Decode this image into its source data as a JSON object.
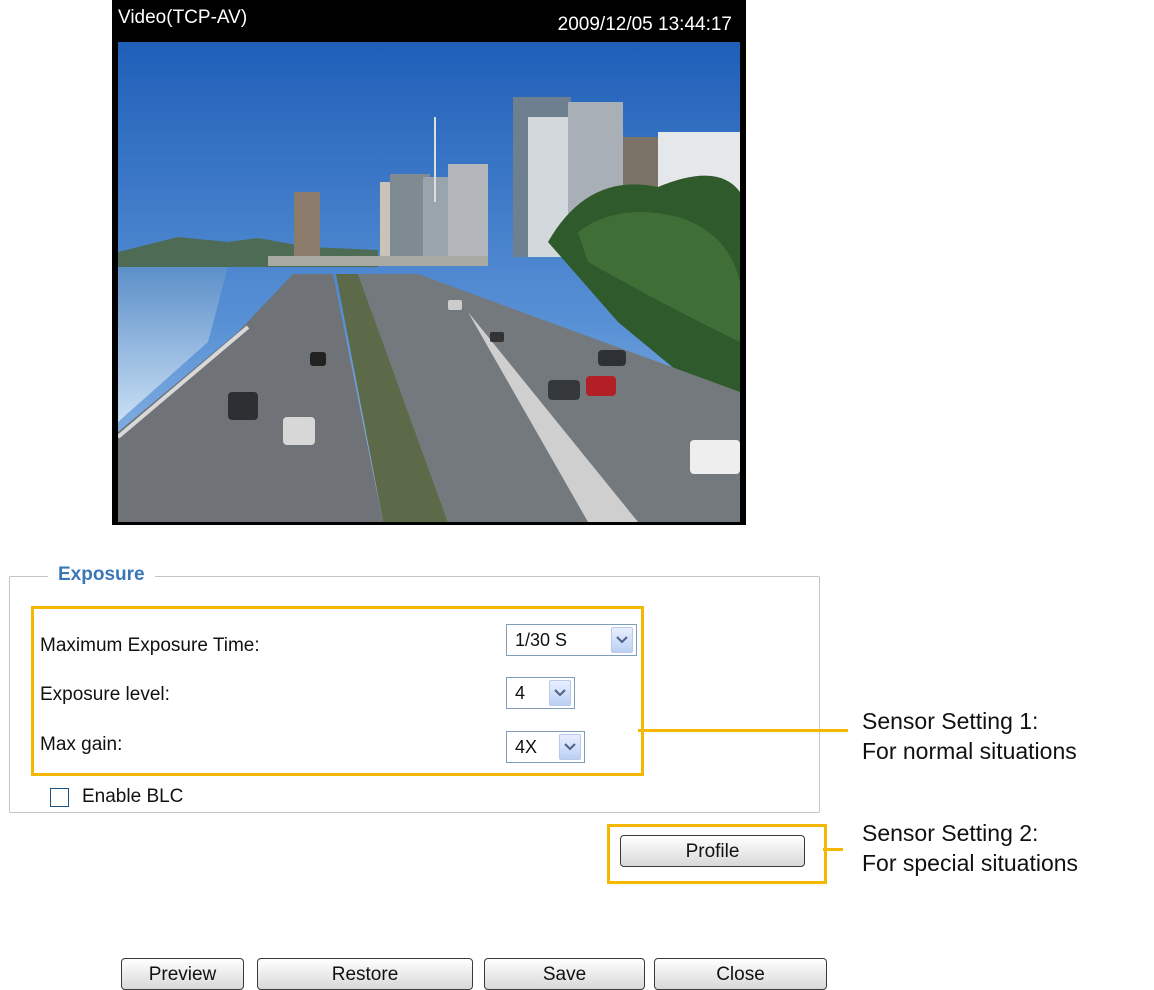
{
  "video": {
    "title": "Video(TCP-AV)",
    "timestamp": "2009/12/05 13:44:17"
  },
  "exposure": {
    "legend": "Exposure",
    "max_exposure_time": {
      "label": "Maximum Exposure Time:",
      "value": "1/30 S"
    },
    "exposure_level": {
      "label": "Exposure level:",
      "value": "4"
    },
    "max_gain": {
      "label": "Max gain:",
      "value": "4X"
    },
    "blc": {
      "label": "Enable BLC",
      "checked": false
    },
    "profile_button": "Profile"
  },
  "annotations": {
    "setting1_line1": "Sensor Setting 1:",
    "setting1_line2": "For normal situations",
    "setting2_line1": "Sensor Setting 2:",
    "setting2_line2": "For special situations"
  },
  "buttons": {
    "preview": "Preview",
    "restore": "Restore",
    "save": "Save",
    "close": "Close"
  },
  "colors": {
    "highlight": "#f5b800",
    "legend": "#3b77b8"
  }
}
